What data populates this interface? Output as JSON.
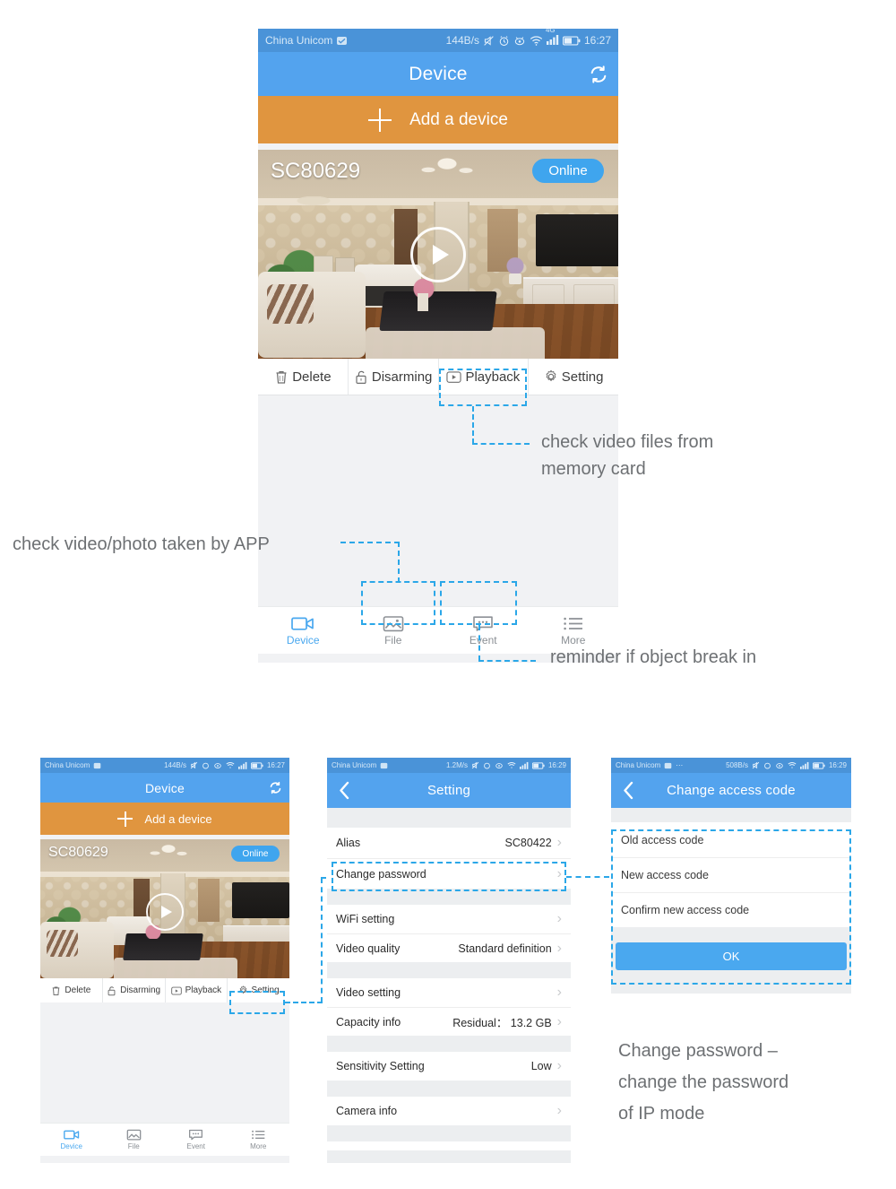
{
  "statusbar": {
    "carrier": "China Unicom",
    "speed_main": "144B/s",
    "speed_setting": "1.2M/s",
    "speed_access": "508B/s",
    "time_main": "16:27",
    "time_setting": "16:29",
    "time_access": "16:29",
    "network_badge": "4G",
    "icons": [
      "mute-icon",
      "alarm-icon",
      "eye-icon",
      "wifi-icon",
      "signal-icon",
      "battery-icon"
    ]
  },
  "device_screen": {
    "title": "Device",
    "refresh_icon": "refresh-icon",
    "add_device_label": "Add a device",
    "card": {
      "name": "SC80629",
      "status_label": "Online",
      "play_icon": "play-icon"
    },
    "actions": [
      {
        "label": "Delete",
        "icon": "trash-icon"
      },
      {
        "label": "Disarming",
        "icon": "unlock-icon"
      },
      {
        "label": "Playback",
        "icon": "play-box-icon"
      },
      {
        "label": "Setting",
        "icon": "gear-icon"
      }
    ],
    "tabs": [
      {
        "label": "Device",
        "icon": "camcorder-icon",
        "active": true
      },
      {
        "label": "File",
        "icon": "photo-icon",
        "active": false
      },
      {
        "label": "Event",
        "icon": "chat-icon",
        "active": false
      },
      {
        "label": "More",
        "icon": "list-icon",
        "active": false
      }
    ]
  },
  "setting_screen": {
    "title": "Setting",
    "back_icon": "chevron-left-icon",
    "rows": [
      {
        "label": "Alias",
        "value": "SC80422"
      },
      {
        "label": "Change password",
        "value": ""
      },
      {
        "label": "WiFi setting",
        "value": ""
      },
      {
        "label": "Video quality",
        "value": "Standard definition"
      },
      {
        "label": "Video setting",
        "value": ""
      },
      {
        "label": "Capacity info",
        "value": "Residual： 13.2 GB"
      },
      {
        "label": "Sensitivity Setting",
        "value": "Low"
      },
      {
        "label": "Camera info",
        "value": ""
      }
    ]
  },
  "access_code_screen": {
    "title": "Change access code",
    "back_icon": "chevron-left-icon",
    "fields": [
      {
        "placeholder": "Old access code"
      },
      {
        "placeholder": "New access code"
      },
      {
        "placeholder": "Confirm new access code"
      }
    ],
    "ok_label": "OK"
  },
  "annotations": {
    "playback": "check video files from\nmemory card",
    "playback_line1": "check video files from",
    "playback_line2": "memory card",
    "file": "check video/photo taken by APP",
    "event": "reminder if object break in",
    "password_line1": "Change password –",
    "password_line2": "change the password",
    "password_line3": "of IP mode"
  },
  "colors": {
    "header_blue": "#53a3ee",
    "statusbar_blue": "#4a93d8",
    "accent_orange": "#e0953f",
    "annotation_blue": "#2ba7e8",
    "page_bg": "#ffffff",
    "list_bg": "#eceef0",
    "online_pill": "#3fa5ee"
  }
}
